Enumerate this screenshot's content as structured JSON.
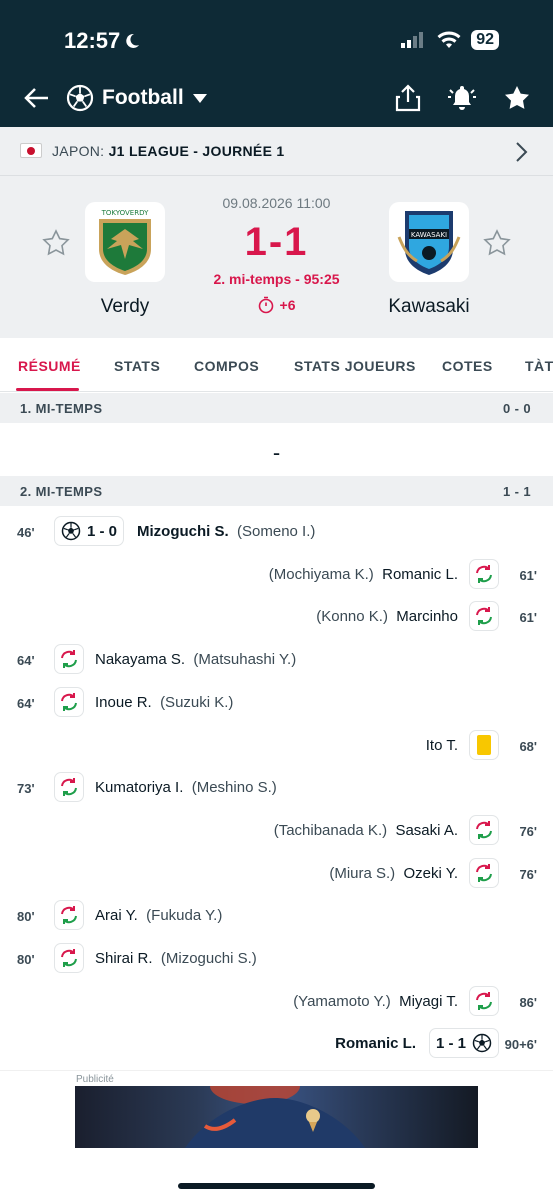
{
  "status": {
    "time": "12:57",
    "battery": "92"
  },
  "nav": {
    "sport": "Football"
  },
  "league": {
    "country": "JAPON:",
    "name": "J1 LEAGUE - JOURNÉE 1"
  },
  "match": {
    "date": "09.08.2026 11:00",
    "score": "1-1",
    "period": "2. mi-temps - 95:25",
    "added_time": "+6",
    "home": {
      "name": "Verdy",
      "logo_text": "TOKYOVERDY"
    },
    "away": {
      "name": "Kawasaki",
      "logo_text": "KAWASAKI"
    }
  },
  "tabs": [
    "RÉSUMÉ",
    "STATS",
    "COMPOS",
    "STATS JOUEURS",
    "COTES",
    "TÀT"
  ],
  "sections": [
    {
      "label": "1. MI-TEMPS",
      "score": "0 - 0"
    },
    {
      "label": "2. MI-TEMPS",
      "score": "1 - 1"
    }
  ],
  "first_half_empty": "-",
  "events": [
    {
      "side": "home",
      "type": "goal",
      "minute": "46'",
      "score": "1 - 0",
      "player": "Mizoguchi S.",
      "assist": "(Someno I.)"
    },
    {
      "side": "away",
      "type": "sub",
      "minute": "61'",
      "player": "Romanic L.",
      "assist": "(Mochiyama K.)"
    },
    {
      "side": "away",
      "type": "sub",
      "minute": "61'",
      "player": "Marcinho",
      "assist": "(Konno K.)"
    },
    {
      "side": "home",
      "type": "sub",
      "minute": "64'",
      "player": "Nakayama S.",
      "assist": "(Matsuhashi Y.)"
    },
    {
      "side": "home",
      "type": "sub",
      "minute": "64'",
      "player": "Inoue R.",
      "assist": "(Suzuki K.)"
    },
    {
      "side": "away",
      "type": "card",
      "minute": "68'",
      "player": "Ito T.",
      "assist": ""
    },
    {
      "side": "home",
      "type": "sub",
      "minute": "73'",
      "player": "Kumatoriya I.",
      "assist": "(Meshino S.)"
    },
    {
      "side": "away",
      "type": "sub",
      "minute": "76'",
      "player": "Sasaki A.",
      "assist": "(Tachibanada K.)"
    },
    {
      "side": "away",
      "type": "sub",
      "minute": "76'",
      "player": "Ozeki Y.",
      "assist": "(Miura S.)"
    },
    {
      "side": "home",
      "type": "sub",
      "minute": "80'",
      "player": "Arai Y.",
      "assist": "(Fukuda Y.)"
    },
    {
      "side": "home",
      "type": "sub",
      "minute": "80'",
      "player": "Shirai R.",
      "assist": "(Mizoguchi S.)"
    },
    {
      "side": "away",
      "type": "sub",
      "minute": "86'",
      "player": "Miyagi T.",
      "assist": "(Yamamoto Y.)"
    },
    {
      "side": "away",
      "type": "goal",
      "minute": "90+6'",
      "score": "1 - 1",
      "player": "Romanic L.",
      "assist": ""
    }
  ],
  "ad": {
    "label": "Publicité"
  },
  "colors": {
    "header": "#0e2a36",
    "accent": "#d8174c",
    "sub_green": "#1e9e4a",
    "sub_red": "#d8174c",
    "card_yellow": "#f8c700"
  }
}
